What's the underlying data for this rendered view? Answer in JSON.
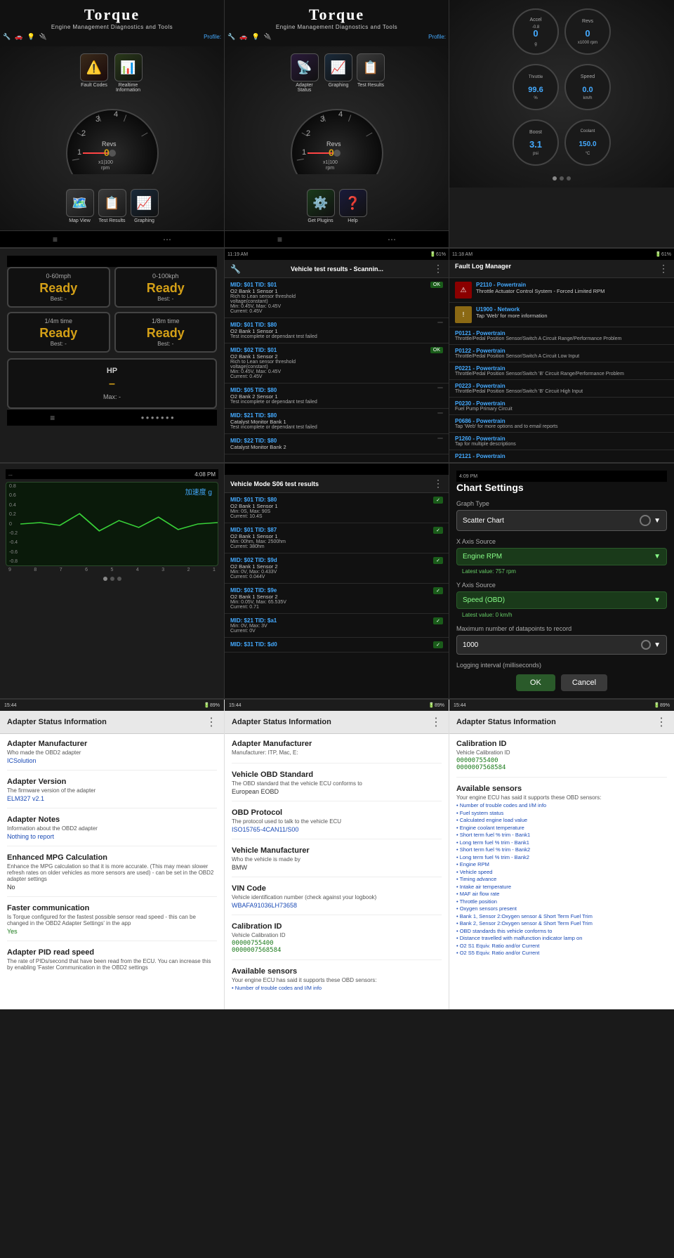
{
  "app": {
    "name": "Torque",
    "tagline": "Engine Management Diagnostics and Tools",
    "profile_label": "Profile:"
  },
  "row1": {
    "screen1": {
      "nav_icons": [
        "🔧",
        "🚗",
        "💡",
        "🔌"
      ],
      "menu_items": [
        {
          "icon": "⚠️",
          "label": "Fault\nCodes"
        },
        {
          "icon": "📊",
          "label": "Realtime\nInformation"
        },
        {
          "icon": "🗺️",
          "label": "Map\nView"
        },
        {
          "icon": "📋",
          "label": "Test\nResults"
        },
        {
          "icon": "📈",
          "label": "Graphing"
        }
      ],
      "gauge_label": "Revs",
      "gauge_value": "0",
      "gauge_unit": "x1|100\nrpm",
      "gauge_ticks": [
        "4",
        "3",
        "2",
        "1"
      ]
    },
    "screen2": {
      "menu_items": [
        {
          "icon": "📡",
          "label": "Adapter\nStatus"
        },
        {
          "icon": "📊",
          "label": "Graphing"
        },
        {
          "icon": "📋",
          "label": "Test\nResults"
        },
        {
          "icon": "⚙️",
          "label": "Get\nPlugins"
        },
        {
          "icon": "❓",
          "label": "Help"
        }
      ],
      "gauge_label": "Revs",
      "gauge_value": "0",
      "gauge_unit": "x1|100\nrpm"
    },
    "screen3": {
      "gauges": [
        {
          "label": "Accel",
          "value": "0",
          "min": "-0.8",
          "unit": "g"
        },
        {
          "label": "Revs",
          "value": "0",
          "unit": "x1000 rpm"
        },
        {
          "label": "Throttle",
          "value": "99.6",
          "unit": "%"
        },
        {
          "label": "Speed",
          "value": "0.0",
          "unit": "km/h"
        },
        {
          "label": "Boost",
          "value": "3.1",
          "unit": "psi"
        },
        {
          "label": "Coolant",
          "value": "150.0",
          "unit": "°C"
        }
      ]
    }
  },
  "row2": {
    "screen1": {
      "status_bar_time": "",
      "perf_cards": [
        {
          "label": "0-60mph",
          "value": "Ready",
          "best": "Best: -"
        },
        {
          "label": "0-100kph",
          "value": "Ready",
          "best": "Best: -"
        },
        {
          "label": "1/4m time",
          "value": "Ready",
          "best": "Best: -"
        },
        {
          "label": "1/8m time",
          "value": "Ready",
          "best": "Best: -"
        }
      ],
      "hp_label": "HP",
      "hp_value": "–",
      "hp_max": "Max: -"
    },
    "screen2": {
      "title": "Vehicle test results - Scannin...",
      "items": [
        {
          "mid": "MID: $01 TID: $01",
          "name": "O2 Bank 1 Sensor 1",
          "desc": "Rich to Lean sensor threshold\nvoltage(constant)",
          "detail": "Min: 0.45V, Max: 0.45V\nCurrent: 0.45V",
          "status": "ok"
        },
        {
          "mid": "MID: $01 TID: $80",
          "name": "O2 Bank 1 Sensor 1",
          "desc": "Test incomplete or dependant test failed",
          "status": "fail"
        },
        {
          "mid": "MID: $02 TID: $01",
          "name": "O2 Bank 1 Sensor 2",
          "desc": "Rich to Lean sensor threshold\nvoltage(constant)",
          "detail": "Min: 0.45V, Max: 0.45V\nCurrent: 0.45V",
          "status": "ok"
        },
        {
          "mid": "MID: $05 TID: $80",
          "name": "O2 Bank 2 Sensor 1",
          "desc": "Test incomplete or dependant test failed",
          "status": "fail"
        },
        {
          "mid": "MID: $21 TID: $80",
          "name": "Catalyst Monitor Bank 1",
          "desc": "Test incomplete or dependant test failed",
          "status": "fail"
        },
        {
          "mid": "MID: $22 TID: $80",
          "name": "Catalyst Monitor Bank 2",
          "status": "fail"
        }
      ]
    },
    "screen3": {
      "title": "Fault Log Manager",
      "faults": [
        {
          "type": "red",
          "code": "P2110 - Powertrain",
          "desc": "Throttle Actuator Control System - Forced\nLimited RPM",
          "icon": "⚠"
        },
        {
          "type": "yellow",
          "code": "U1900 - Network",
          "desc": "Tap 'Web' for more information",
          "icon": "!"
        },
        {
          "code": "P0121 - Powertrain",
          "desc": "Throttle/Pedal Position Sensor/Switch A Circuit\nRange/Performance Problem"
        },
        {
          "code": "P0122 - Powertrain",
          "desc": "Throttle/Pedal Position Sensor/Switch A Circuit Low\nInput"
        },
        {
          "code": "P0221 - Powertrain",
          "desc": "Throttle/Pedal Position Sensor/Switch 'B' Circuit\nRange/Performance Problem"
        },
        {
          "code": "P0223 - Powertrain",
          "desc": "Throttle/Pedal Position Sensor/Switch 'B' Circuit High\nInput"
        },
        {
          "code": "P0230 - Powertrain",
          "desc": "Fuel Pump Primary Circuit"
        },
        {
          "code": "P0686 - Powertrain",
          "desc": "Tap Web' for more options and to email reports"
        },
        {
          "code": "P1260 - Powertrain",
          "desc": "Tap for multiple descriptions"
        },
        {
          "code": "P2121 - Powertrain",
          "desc": ""
        }
      ]
    }
  },
  "row3": {
    "screen1": {
      "status_time": "4:08 PM",
      "graph_label": "加速度 g",
      "y_ticks": [
        "0.8",
        "0.6",
        "0.4",
        "0.2",
        "0",
        "-0.2",
        "-0.4",
        "-0.6",
        "-0.8"
      ],
      "x_ticks": [
        "9",
        "8",
        "7",
        "6",
        "5",
        "4",
        "3",
        "2",
        "1"
      ]
    },
    "screen2": {
      "title": "Vehicle Mode S06 test results",
      "items": [
        {
          "mid": "MID: $01 TID: $80",
          "name": "O2 Bank 1 Sensor 1",
          "detail": "Min: 0S, Max: 90S\nCurrent: 10.4S",
          "status": "ok"
        },
        {
          "mid": "MID: $01 TID: $87",
          "name": "O2 Bank 1 Sensor 1",
          "detail": "Min: 00hm, Max: 2500hm\nCurrent: 380hm",
          "status": "ok"
        },
        {
          "mid": "MID: $02 TID: $9d",
          "name": "O2 Bank 1 Sensor 2",
          "detail": "Min: 0V, Max: 0.433V\nCurrent: 0.044V",
          "status": "ok"
        },
        {
          "mid": "MID: $02 TID: $9e",
          "name": "O2 Bank 1 Sensor 2",
          "detail": "Min: 0.05V, Max: 65.535V\nCurrent: 0.71",
          "status": "ok"
        },
        {
          "mid": "MID: $21 TID: $a1",
          "name": "",
          "detail": "Min: 0V, Max: 3V\nCurrent: 0V",
          "status": "ok"
        },
        {
          "mid": "MID: $31 TID: $d0",
          "name": "",
          "detail": "",
          "status": "ok"
        }
      ]
    },
    "screen3": {
      "title": "Chart Settings",
      "graph_type_label": "Graph Type",
      "graph_type_value": "Scatter Chart",
      "x_axis_label": "X Axis Source",
      "x_axis_value": "Engine RPM",
      "x_axis_current": "Latest value: 757 rpm",
      "y_axis_label": "Y Axis Source",
      "y_axis_value": "Speed (OBD)",
      "y_axis_current": "Latest value: 0 km/h",
      "max_datapoints_label": "Maximum number of datapoints to record",
      "max_datapoints_value": "1000",
      "log_interval_label": "Logging interval (milliseconds)",
      "ok_label": "OK",
      "cancel_label": "Cancel"
    }
  },
  "row4": {
    "screen1": {
      "time": "15:44",
      "title": "Adapter Status Information",
      "sections": [
        {
          "title": "Adapter Manufacturer",
          "desc": "Who made the OBD2 adapter",
          "value": "ICSolution",
          "value_type": "blue"
        },
        {
          "title": "Adapter Version",
          "desc": "The firmware version of the adapter",
          "value": "ELM327 v2.1",
          "value_type": "blue"
        },
        {
          "title": "Adapter Notes",
          "desc": "Information about the OBD2 adapter",
          "value": "Nothing to report",
          "value_type": "blue"
        },
        {
          "title": "Enhanced MPG Calculation",
          "desc": "Enhance the MPG calculation so that it is more accurate. (This may mean slower refresh rates on older vehicles as more sensors are used) - can be set in the OBD2 adapter settings",
          "value": "No",
          "value_type": "normal"
        },
        {
          "title": "Faster communication",
          "desc": "Is Torque configured for the fastest possible sensor read speed - this can be changed in the OBD2 Adapter Settings' in the app",
          "value": "Yes",
          "value_type": "green"
        },
        {
          "title": "Adapter PID read speed",
          "desc": "The rate of PIDs/second that have been read from the ECU. You can increase this by enabling 'Faster Communication in the OBD2 settings",
          "value": "",
          "value_type": "normal"
        }
      ]
    },
    "screen2": {
      "time": "15:44",
      "title": "Adapter Status Information",
      "sections": [
        {
          "title": "Adapter Manufacturer",
          "desc": "Manufacturer: ITP, Mac, E:",
          "value": "",
          "value_type": "normal"
        },
        {
          "title": "Vehicle OBD Standard",
          "desc": "The OBD standard that the vehicle ECU conforms to",
          "value": "European EOBD",
          "value_type": "normal"
        },
        {
          "title": "OBD Protocol",
          "desc": "The protocol used to talk to the vehicle ECU",
          "value": "ISO15765-4CAN11/S00",
          "value_type": "blue"
        },
        {
          "title": "Vehicle Manufacturer",
          "desc": "Who the vehicle is made by",
          "value": "BMW",
          "value_type": "normal"
        },
        {
          "title": "VIN Code",
          "desc": "Vehicle identification number (check against your logbook)",
          "value": "WBAFA91036LH73658",
          "value_type": "blue"
        },
        {
          "title": "Calibration ID",
          "desc": "Vehicle Calibration ID",
          "value1": "00000755400",
          "value2": "0000007568584",
          "value_type": "green"
        },
        {
          "title": "Available sensors",
          "desc": "Your engine ECU has said it supports these OBD sensors:",
          "value": "• Number of trouble codes and I/M info",
          "value_type": "normal"
        }
      ]
    },
    "screen3": {
      "time": "15:44",
      "title": "Adapter Status Information",
      "calibration_section": {
        "title": "Calibration ID",
        "desc": "Vehicle Calibration ID",
        "value1": "00000755400",
        "value2": "0000007568584"
      },
      "available_sensors": {
        "title": "Available sensors",
        "desc": "Your engine ECU has said it supports these OBD sensors:",
        "sensors": [
          "• Number of trouble codes and I/M info",
          "• Fuel system status",
          "• Calculated engine load value",
          "• Engine coolant temperature",
          "• Short term fuel % trim - Bank1",
          "• Long term fuel % trim - Bank1",
          "• Short term fuel % trim - Bank2",
          "• Long term fuel % trim - Bank2",
          "• Engine RPM",
          "• Vehicle speed",
          "• Timing advance",
          "• Intake air temperature",
          "• MAF air flow rate",
          "• Throttle position",
          "• Oxygen sensors present",
          "• Bank 1, Sensor 2:Oxygen sensor & Short Term Fuel Trim",
          "• Bank 2, Sensor 2:Oxygen sensor & Short Term Fuel Trim",
          "• OBD standards this vehicle conforms to",
          "• Distance travelled with malfunction indicator lamp on",
          "• O2 S1 Equiv. Ratio and/or Current",
          "• O2 S5 Equiv. Ratio and/or Current"
        ]
      }
    }
  }
}
